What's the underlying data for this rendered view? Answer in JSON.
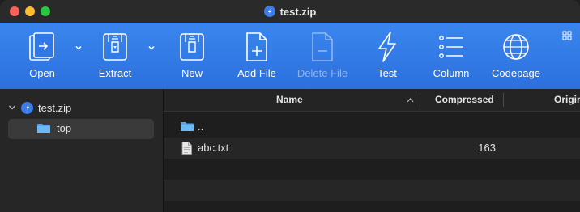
{
  "window": {
    "title": "test.zip"
  },
  "toolbar": {
    "open": "Open",
    "extract": "Extract",
    "new": "New",
    "add_file": "Add File",
    "delete_file": "Delete File",
    "test": "Test",
    "column": "Column",
    "codepage": "Codepage"
  },
  "sidebar": {
    "root": "test.zip",
    "child": "top"
  },
  "table": {
    "columns": {
      "name": "Name",
      "compressed": "Compressed",
      "original": "Origin"
    },
    "rows": [
      {
        "name": "..",
        "compressed": ""
      },
      {
        "name": "abc.txt",
        "compressed": "163"
      }
    ]
  }
}
